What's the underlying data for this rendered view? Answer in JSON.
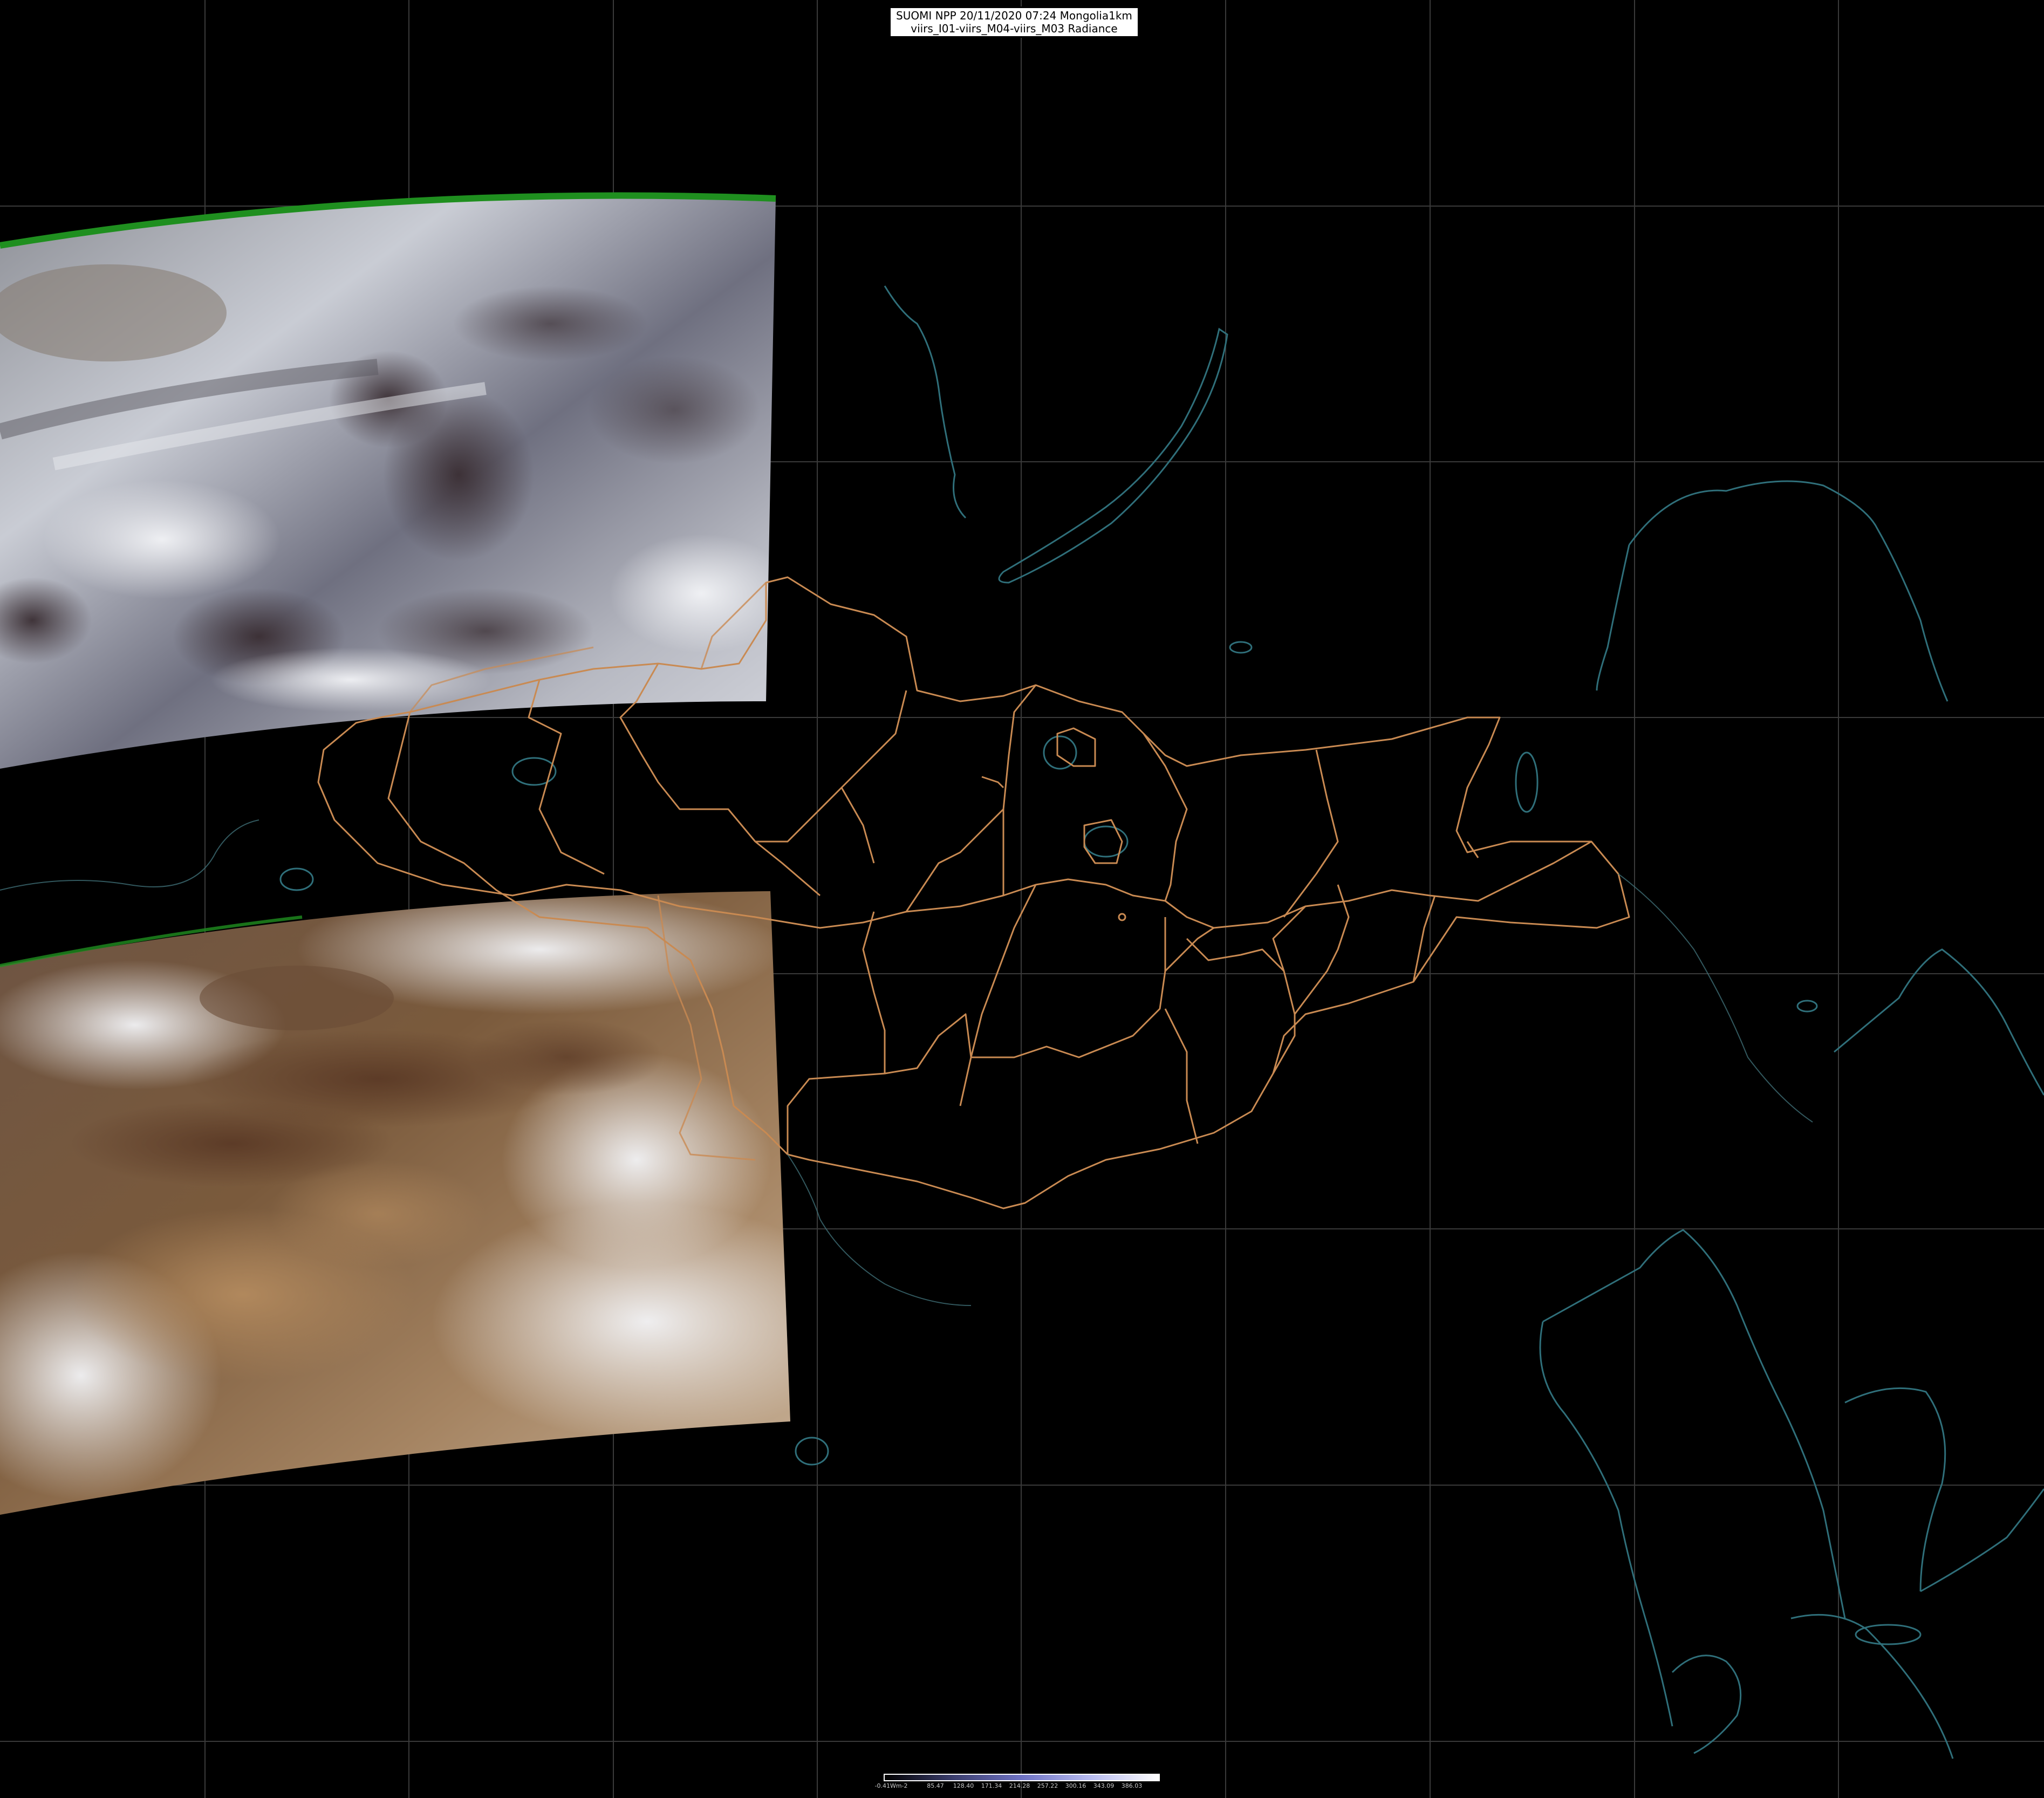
{
  "header": {
    "line1": "SUOMI NPP 20/11/2020 07:24 Mongolia1km",
    "line2": "viirs_I01-viirs_M04-viirs_M03 Radiance"
  },
  "legend": {
    "labels": [
      "-0.41Wm-2",
      "85.47",
      "128.40",
      "171.34",
      "214.28",
      "257.22",
      "300.16",
      "343.09",
      "386.03"
    ],
    "colors": [
      "#000000",
      "#3b3e6e",
      "#6e72c4",
      "#b8bcf0",
      "#ffffff"
    ]
  },
  "map": {
    "background": "#000000",
    "grid_color": "#3a3a3a",
    "admin_border_color": "#c98a52",
    "coastline_color": "#2f6f7a",
    "swath_edge_color": "#1f8f1f",
    "layers": [
      "imagery-swath-north",
      "imagery-swath-south",
      "admin-borders",
      "coastlines",
      "lat-lon-grid"
    ]
  }
}
